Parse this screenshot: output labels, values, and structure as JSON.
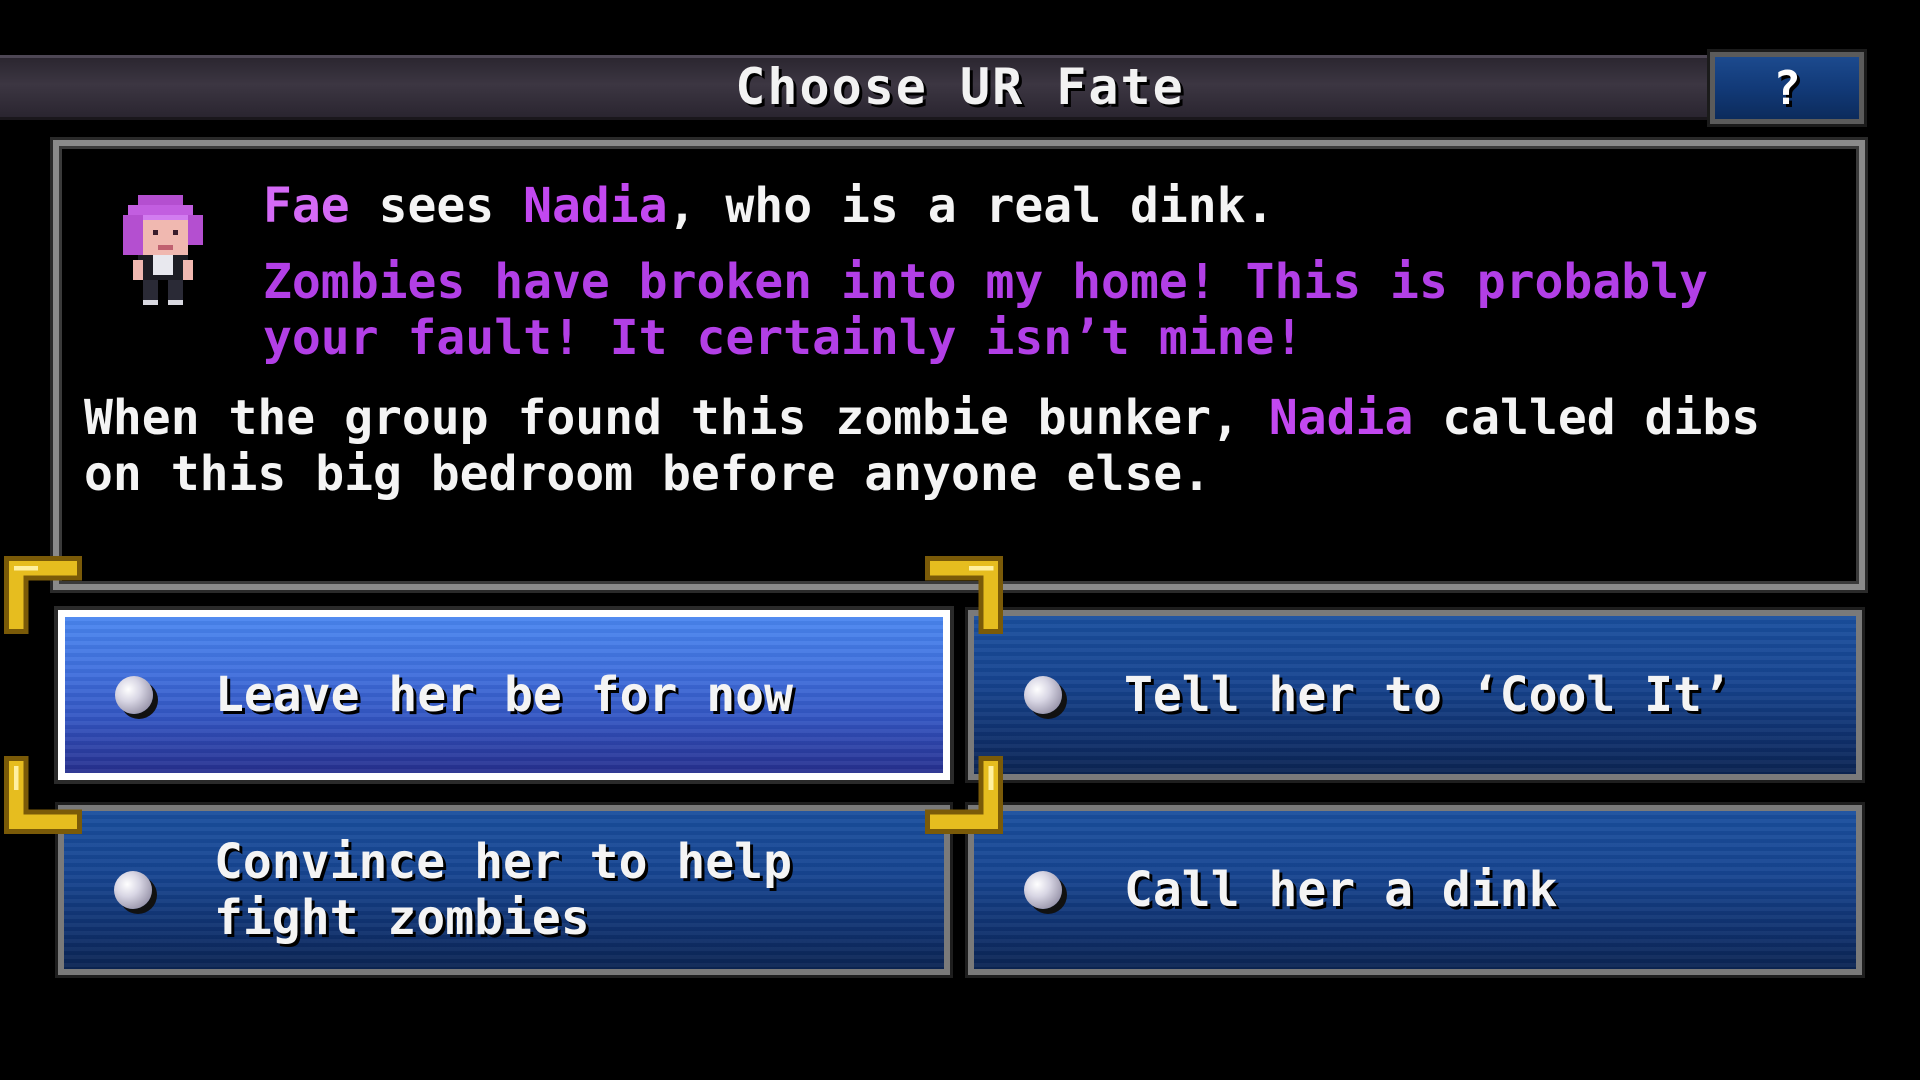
{
  "header": {
    "title": "Choose UR Fate",
    "help_label": "?"
  },
  "dialog": {
    "speaker": "Fae",
    "verb": "sees",
    "target": "Nadia",
    "description": ", who is a real dink.",
    "quote": "Zombies have broken into my home! This is probably your fault! It certainly isn’t mine!",
    "narration_before": "When the group found this zombie bunker,",
    "narration_name": "Nadia",
    "narration_after": "called dibs on this big bedroom before anyone else."
  },
  "choices": [
    {
      "label": "Leave her be for now",
      "selected": true
    },
    {
      "label": "Tell her to ‘Cool It’",
      "selected": false
    },
    {
      "label": "Convince her to help fight zombies",
      "selected": false
    },
    {
      "label": "Call her a dink",
      "selected": false
    }
  ],
  "colors": {
    "speaker_name": "#d46af6",
    "quote_text": "#b23fe6",
    "choice_bg": "#174591",
    "choice_selected_bg": "#3f6fdd",
    "cursor_gold": "#e0b81c"
  },
  "icons": {
    "help": "question-mark-icon",
    "bullet": "bullet-orb-icon",
    "cursor": "gold-corner-cursor-icon"
  }
}
